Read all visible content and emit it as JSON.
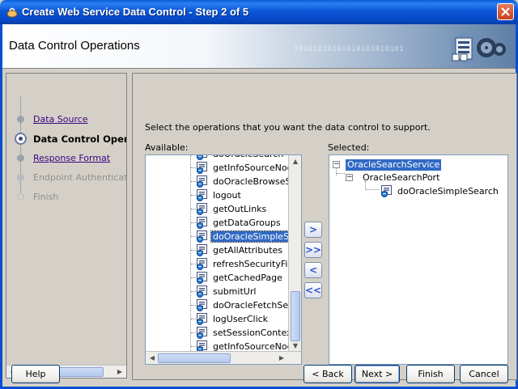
{
  "window": {
    "title": "Create Web Service Data Control - Step 2 of 5"
  },
  "header": {
    "page_title": "Data Control Operations",
    "banner_pattern": "10101010101010101010101"
  },
  "train": {
    "steps": [
      {
        "label": "Data Source",
        "state": "link"
      },
      {
        "label": "Data Control Operations",
        "state": "current"
      },
      {
        "label": "Response Format",
        "state": "link"
      },
      {
        "label": "Endpoint Authentication",
        "state": "disabled"
      },
      {
        "label": "Finish",
        "state": "disabled"
      }
    ]
  },
  "content": {
    "instructions": "Select the operations that you want the data control to support.",
    "available_label": "Available:",
    "selected_label": "Selected:",
    "available_items": [
      "doOracleSearch",
      "getInfoSourceNodes",
      "doOracleBrowseSearch",
      "logout",
      "getOutLinks",
      "getDataGroups",
      "doOracleSimpleSearch",
      "getAllAttributes",
      "refreshSecurityFilter",
      "getCachedPage",
      "submitUrl",
      "doOracleFetchSearch",
      "logUserClick",
      "setSessionContext",
      "getInfoSourceNode"
    ],
    "available_selected": "doOracleSimpleSearch",
    "selected_tree": {
      "service": "OracleSearchService",
      "port": "OracleSearchPort",
      "operation": "doOracleSimpleSearch"
    },
    "shuttle": {
      "move": ">",
      "move_all": ">>",
      "remove": "<",
      "remove_all": "<<"
    }
  },
  "buttons": {
    "help": "Help",
    "back": "< Back",
    "next": "Next >",
    "finish": "Finish",
    "cancel": "Cancel"
  },
  "colors": {
    "titlebar": "#0a5fd8",
    "selection": "#316ac5",
    "link": "#400080"
  },
  "icons": {
    "app": "jdeveloper-icon",
    "operation": "web-service-operation-icon",
    "banner": "data-control-graphic"
  }
}
